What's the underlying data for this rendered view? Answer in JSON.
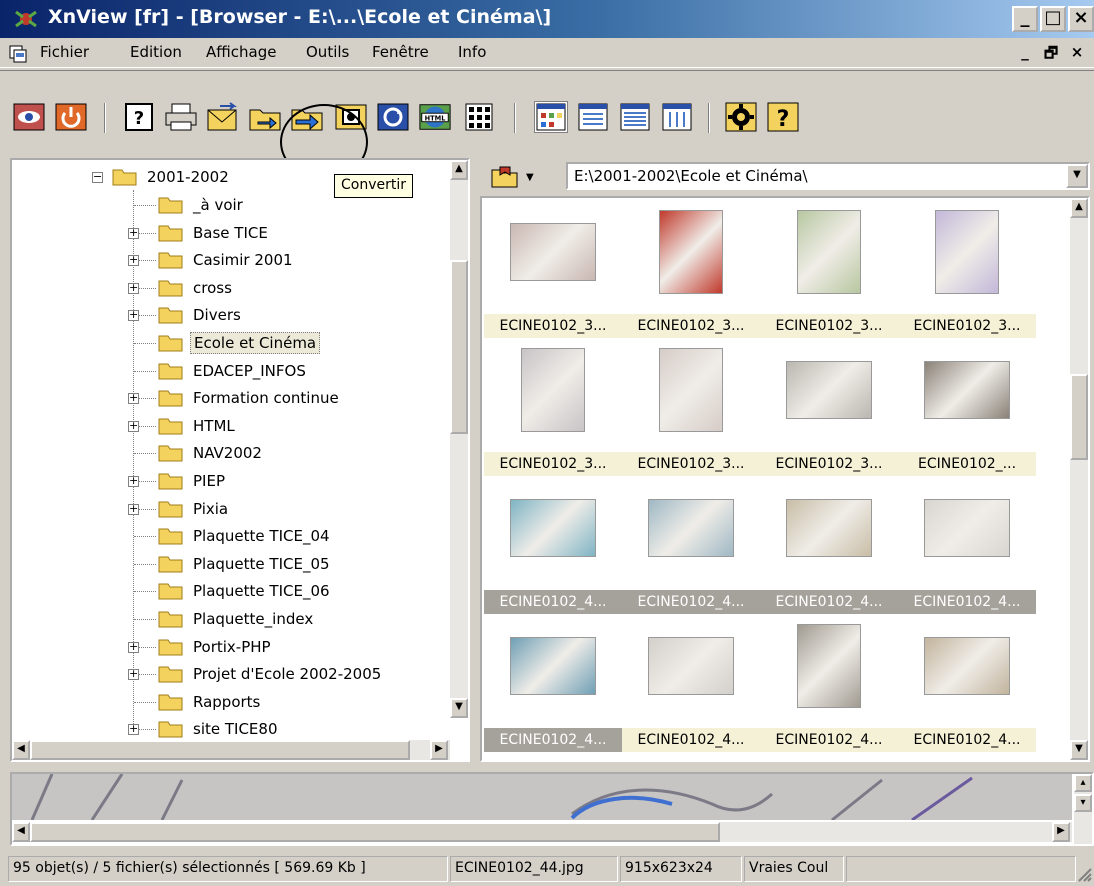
{
  "window": {
    "title": "XnView [fr] - [Browser - E:\\...\\Ecole et Cinéma\\]",
    "minimize_glyph": "_",
    "maximize_glyph": "□",
    "close_glyph": "×"
  },
  "menu": {
    "items": [
      "Fichier",
      "Edition",
      "Affichage",
      "Outils",
      "Fenêtre",
      "Info"
    ],
    "mdi_minimize": "_",
    "mdi_restore": "🗗",
    "mdi_close": "×"
  },
  "toolbar": {
    "tooltip": "Convertir",
    "help_glyph": "?",
    "html_label": "HTML"
  },
  "tree": {
    "root": "2001-2002",
    "items": [
      {
        "label": "_à voir",
        "expandable": false
      },
      {
        "label": "Base TICE",
        "expandable": true
      },
      {
        "label": "Casimir 2001",
        "expandable": true
      },
      {
        "label": "cross",
        "expandable": true
      },
      {
        "label": "Divers",
        "expandable": true
      },
      {
        "label": "Ecole et Cinéma",
        "expandable": false,
        "selected": true
      },
      {
        "label": "EDACEP_INFOS",
        "expandable": false
      },
      {
        "label": "Formation continue",
        "expandable": true
      },
      {
        "label": "HTML",
        "expandable": true
      },
      {
        "label": "NAV2002",
        "expandable": false
      },
      {
        "label": "PIEP",
        "expandable": true
      },
      {
        "label": "Pixia",
        "expandable": true
      },
      {
        "label": "Plaquette TICE_04",
        "expandable": false
      },
      {
        "label": "Plaquette TICE_05",
        "expandable": false
      },
      {
        "label": "Plaquette TICE_06",
        "expandable": false
      },
      {
        "label": "Plaquette_index",
        "expandable": false
      },
      {
        "label": "Portix-PHP",
        "expandable": true
      },
      {
        "label": "Projet d'Ecole 2002-2005",
        "expandable": true
      },
      {
        "label": "Rapports",
        "expandable": false
      },
      {
        "label": "site TICE80",
        "expandable": true
      }
    ]
  },
  "browser": {
    "path": "E:\\2001-2002\\Ecole et Cinéma\\",
    "thumbnails": [
      {
        "name": "ECINE0102_3...",
        "selected": false,
        "color": "#c9b7b2"
      },
      {
        "name": "ECINE0102_3...",
        "selected": false,
        "color": "#c0392b"
      },
      {
        "name": "ECINE0102_3...",
        "selected": false,
        "color": "#b7c7a0"
      },
      {
        "name": "ECINE0102_3...",
        "selected": false,
        "color": "#c3b8d9"
      },
      {
        "name": "ECINE0102_3...",
        "selected": false,
        "color": "#c8c3c6"
      },
      {
        "name": "ECINE0102_3...",
        "selected": false,
        "color": "#d6ccc8"
      },
      {
        "name": "ECINE0102_3...",
        "selected": false,
        "color": "#b9b7b0"
      },
      {
        "name": "ECINE0102_...",
        "selected": false,
        "color": "#8a8278"
      },
      {
        "name": "ECINE0102_4...",
        "selected": true,
        "color": "#7fb4c4"
      },
      {
        "name": "ECINE0102_4...",
        "selected": true,
        "color": "#9fb8c4"
      },
      {
        "name": "ECINE0102_4...",
        "selected": true,
        "color": "#c8bda6"
      },
      {
        "name": "ECINE0102_4...",
        "selected": true,
        "color": "#d9d6d2"
      },
      {
        "name": "ECINE0102_4...",
        "selected": true,
        "color": "#6f9fb5"
      },
      {
        "name": "ECINE0102_4...",
        "selected": false,
        "color": "#d3d0cb"
      },
      {
        "name": "ECINE0102_4...",
        "selected": false,
        "color": "#a09a90"
      },
      {
        "name": "ECINE0102_4...",
        "selected": false,
        "color": "#c2b49d"
      }
    ]
  },
  "status": {
    "selection": "95 objet(s) / 5 fichier(s) sélectionnés  [ 569.69 Kb ]",
    "filename": "ECINE0102_44.jpg",
    "dimensions": "915x623x24",
    "colors": "Vraies Coul",
    "empty": ""
  },
  "colors": {
    "titlebar_start": "#0a246a",
    "titlebar_end": "#a6caf0",
    "folder_yellow": "#f4d25e",
    "selected_label_bg": "#a5a29b",
    "label_bg": "#f5f1d6"
  }
}
